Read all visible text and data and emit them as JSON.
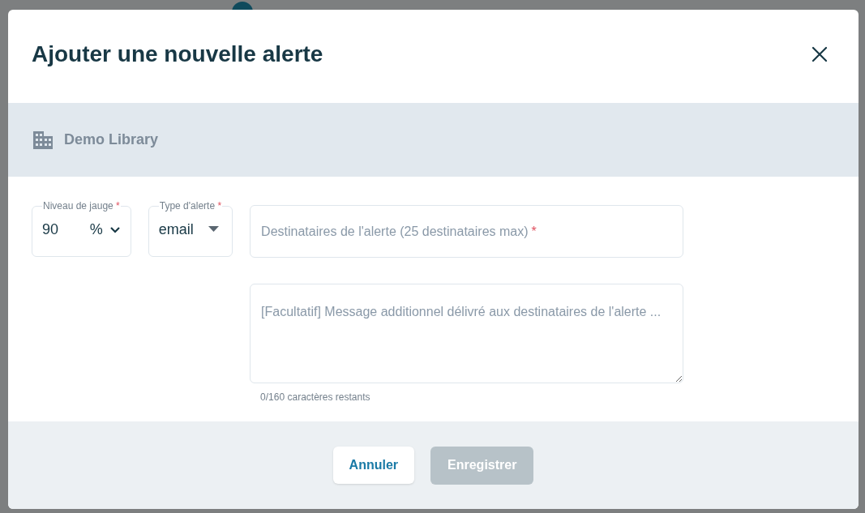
{
  "dialog": {
    "title": "Ajouter une nouvelle alerte",
    "library": "Demo Library",
    "gauge_field": {
      "label": "Niveau de jauge",
      "required_mark": "*",
      "value": "90",
      "unit": "%"
    },
    "type_field": {
      "label": "Type d'alerte",
      "required_mark": "*",
      "value": "email"
    },
    "recipients_field": {
      "placeholder": "Destinataires de l'alerte (25 destinataires max)",
      "required_mark": "*"
    },
    "message_field": {
      "placeholder": "[Facultatif] Message additionnel délivré aux destinataires de l'alerte ..."
    },
    "counter": "0/160 caractères restants",
    "buttons": [
      {
        "label": "Annuler",
        "disabled": false
      },
      {
        "label": "Enregistrer",
        "disabled": true
      }
    ]
  }
}
